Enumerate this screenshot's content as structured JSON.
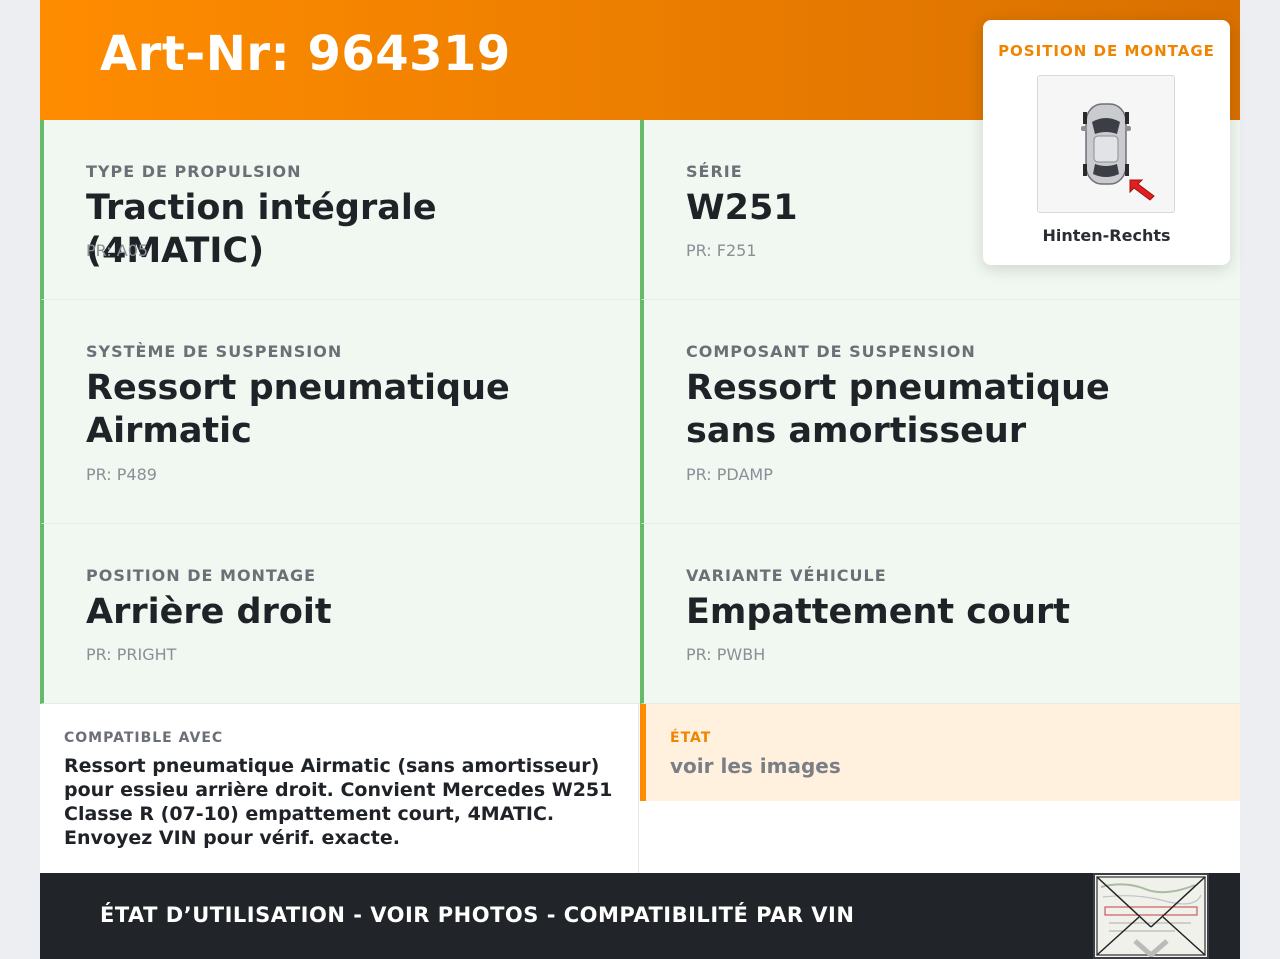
{
  "header": {
    "title": "Art-Nr: 964319"
  },
  "mount_panel": {
    "title": "POSITION DE MONTAGE",
    "caption": "Hinten-Rechts",
    "image_icon": "car-top-view-icon",
    "arrow_color": "#e02020"
  },
  "attributes": [
    {
      "label": "TYPE DE PROPULSION",
      "value": "Traction intégrale (4MATIC)",
      "pr": "PR: A05"
    },
    {
      "label": "SÉRIE",
      "value": "W251",
      "pr": "PR: F251"
    },
    {
      "label": "SYSTÈME DE SUSPENSION",
      "value": "Ressort pneumatique Airmatic",
      "pr": "PR: P489"
    },
    {
      "label": "COMPOSANT DE SUSPENSION",
      "value": "Ressort pneumatique sans amortisseur",
      "pr": "PR: PDAMP"
    },
    {
      "label": "POSITION DE MONTAGE",
      "value": "Arrière droit",
      "pr": "PR: PRIGHT"
    },
    {
      "label": "VARIANTE VÉHICULE",
      "value": "Empattement court",
      "pr": "PR: PWBH"
    }
  ],
  "compat": {
    "label": "COMPATIBLE AVEC",
    "text": "Ressort pneumatique Airmatic (sans amortisseur) pour essieu arrière droit. Convient Mercedes W251 Classe R (07-10) empattement court, 4MATIC. Envoyez VIN pour vérif. exacte."
  },
  "etat": {
    "label": "ÉTAT",
    "text": "voir les images"
  },
  "footer": {
    "text": "ÉTAT D’UTILISATION - VOIR PHOTOS - COMPATIBILITÉ PAR VIN",
    "thumbnail_icon": "envelope-document-icon"
  },
  "colors": {
    "accent_orange": "#ff8c00",
    "accent_green": "#66bb6a",
    "cell_bg": "#f1f8f1",
    "footer_bg": "#212429"
  }
}
